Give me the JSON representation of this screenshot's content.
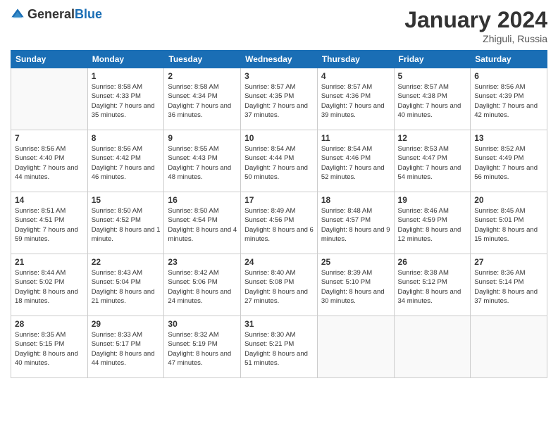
{
  "header": {
    "logo_general": "General",
    "logo_blue": "Blue",
    "month_title": "January 2024",
    "location": "Zhiguli, Russia"
  },
  "weekdays": [
    "Sunday",
    "Monday",
    "Tuesday",
    "Wednesday",
    "Thursday",
    "Friday",
    "Saturday"
  ],
  "weeks": [
    [
      {
        "day": "",
        "sunrise": "",
        "sunset": "",
        "daylight": ""
      },
      {
        "day": "1",
        "sunrise": "Sunrise: 8:58 AM",
        "sunset": "Sunset: 4:33 PM",
        "daylight": "Daylight: 7 hours and 35 minutes."
      },
      {
        "day": "2",
        "sunrise": "Sunrise: 8:58 AM",
        "sunset": "Sunset: 4:34 PM",
        "daylight": "Daylight: 7 hours and 36 minutes."
      },
      {
        "day": "3",
        "sunrise": "Sunrise: 8:57 AM",
        "sunset": "Sunset: 4:35 PM",
        "daylight": "Daylight: 7 hours and 37 minutes."
      },
      {
        "day": "4",
        "sunrise": "Sunrise: 8:57 AM",
        "sunset": "Sunset: 4:36 PM",
        "daylight": "Daylight: 7 hours and 39 minutes."
      },
      {
        "day": "5",
        "sunrise": "Sunrise: 8:57 AM",
        "sunset": "Sunset: 4:38 PM",
        "daylight": "Daylight: 7 hours and 40 minutes."
      },
      {
        "day": "6",
        "sunrise": "Sunrise: 8:56 AM",
        "sunset": "Sunset: 4:39 PM",
        "daylight": "Daylight: 7 hours and 42 minutes."
      }
    ],
    [
      {
        "day": "7",
        "sunrise": "Sunrise: 8:56 AM",
        "sunset": "Sunset: 4:40 PM",
        "daylight": "Daylight: 7 hours and 44 minutes."
      },
      {
        "day": "8",
        "sunrise": "Sunrise: 8:56 AM",
        "sunset": "Sunset: 4:42 PM",
        "daylight": "Daylight: 7 hours and 46 minutes."
      },
      {
        "day": "9",
        "sunrise": "Sunrise: 8:55 AM",
        "sunset": "Sunset: 4:43 PM",
        "daylight": "Daylight: 7 hours and 48 minutes."
      },
      {
        "day": "10",
        "sunrise": "Sunrise: 8:54 AM",
        "sunset": "Sunset: 4:44 PM",
        "daylight": "Daylight: 7 hours and 50 minutes."
      },
      {
        "day": "11",
        "sunrise": "Sunrise: 8:54 AM",
        "sunset": "Sunset: 4:46 PM",
        "daylight": "Daylight: 7 hours and 52 minutes."
      },
      {
        "day": "12",
        "sunrise": "Sunrise: 8:53 AM",
        "sunset": "Sunset: 4:47 PM",
        "daylight": "Daylight: 7 hours and 54 minutes."
      },
      {
        "day": "13",
        "sunrise": "Sunrise: 8:52 AM",
        "sunset": "Sunset: 4:49 PM",
        "daylight": "Daylight: 7 hours and 56 minutes."
      }
    ],
    [
      {
        "day": "14",
        "sunrise": "Sunrise: 8:51 AM",
        "sunset": "Sunset: 4:51 PM",
        "daylight": "Daylight: 7 hours and 59 minutes."
      },
      {
        "day": "15",
        "sunrise": "Sunrise: 8:50 AM",
        "sunset": "Sunset: 4:52 PM",
        "daylight": "Daylight: 8 hours and 1 minute."
      },
      {
        "day": "16",
        "sunrise": "Sunrise: 8:50 AM",
        "sunset": "Sunset: 4:54 PM",
        "daylight": "Daylight: 8 hours and 4 minutes."
      },
      {
        "day": "17",
        "sunrise": "Sunrise: 8:49 AM",
        "sunset": "Sunset: 4:56 PM",
        "daylight": "Daylight: 8 hours and 6 minutes."
      },
      {
        "day": "18",
        "sunrise": "Sunrise: 8:48 AM",
        "sunset": "Sunset: 4:57 PM",
        "daylight": "Daylight: 8 hours and 9 minutes."
      },
      {
        "day": "19",
        "sunrise": "Sunrise: 8:46 AM",
        "sunset": "Sunset: 4:59 PM",
        "daylight": "Daylight: 8 hours and 12 minutes."
      },
      {
        "day": "20",
        "sunrise": "Sunrise: 8:45 AM",
        "sunset": "Sunset: 5:01 PM",
        "daylight": "Daylight: 8 hours and 15 minutes."
      }
    ],
    [
      {
        "day": "21",
        "sunrise": "Sunrise: 8:44 AM",
        "sunset": "Sunset: 5:02 PM",
        "daylight": "Daylight: 8 hours and 18 minutes."
      },
      {
        "day": "22",
        "sunrise": "Sunrise: 8:43 AM",
        "sunset": "Sunset: 5:04 PM",
        "daylight": "Daylight: 8 hours and 21 minutes."
      },
      {
        "day": "23",
        "sunrise": "Sunrise: 8:42 AM",
        "sunset": "Sunset: 5:06 PM",
        "daylight": "Daylight: 8 hours and 24 minutes."
      },
      {
        "day": "24",
        "sunrise": "Sunrise: 8:40 AM",
        "sunset": "Sunset: 5:08 PM",
        "daylight": "Daylight: 8 hours and 27 minutes."
      },
      {
        "day": "25",
        "sunrise": "Sunrise: 8:39 AM",
        "sunset": "Sunset: 5:10 PM",
        "daylight": "Daylight: 8 hours and 30 minutes."
      },
      {
        "day": "26",
        "sunrise": "Sunrise: 8:38 AM",
        "sunset": "Sunset: 5:12 PM",
        "daylight": "Daylight: 8 hours and 34 minutes."
      },
      {
        "day": "27",
        "sunrise": "Sunrise: 8:36 AM",
        "sunset": "Sunset: 5:14 PM",
        "daylight": "Daylight: 8 hours and 37 minutes."
      }
    ],
    [
      {
        "day": "28",
        "sunrise": "Sunrise: 8:35 AM",
        "sunset": "Sunset: 5:15 PM",
        "daylight": "Daylight: 8 hours and 40 minutes."
      },
      {
        "day": "29",
        "sunrise": "Sunrise: 8:33 AM",
        "sunset": "Sunset: 5:17 PM",
        "daylight": "Daylight: 8 hours and 44 minutes."
      },
      {
        "day": "30",
        "sunrise": "Sunrise: 8:32 AM",
        "sunset": "Sunset: 5:19 PM",
        "daylight": "Daylight: 8 hours and 47 minutes."
      },
      {
        "day": "31",
        "sunrise": "Sunrise: 8:30 AM",
        "sunset": "Sunset: 5:21 PM",
        "daylight": "Daylight: 8 hours and 51 minutes."
      },
      {
        "day": "",
        "sunrise": "",
        "sunset": "",
        "daylight": ""
      },
      {
        "day": "",
        "sunrise": "",
        "sunset": "",
        "daylight": ""
      },
      {
        "day": "",
        "sunrise": "",
        "sunset": "",
        "daylight": ""
      }
    ]
  ]
}
